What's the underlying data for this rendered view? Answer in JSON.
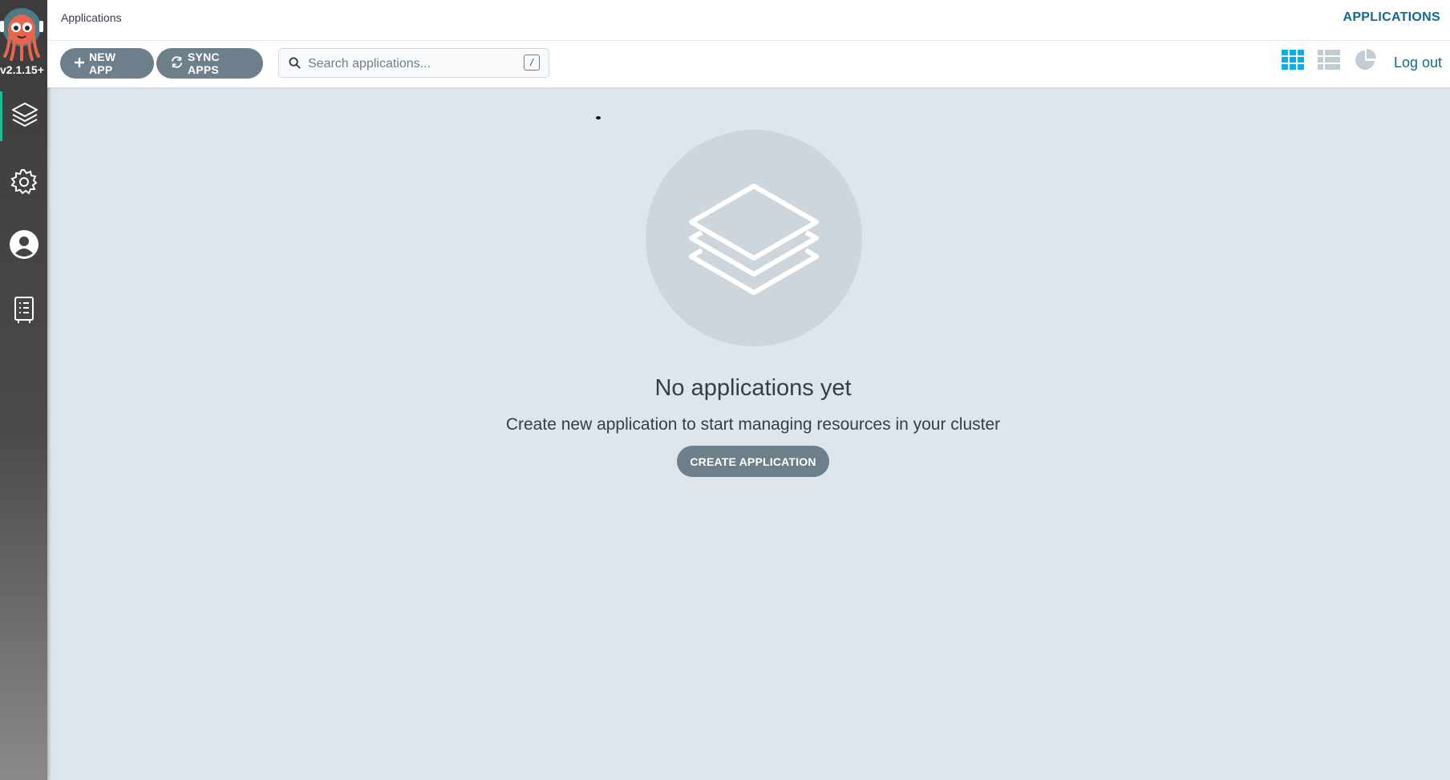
{
  "sidebar": {
    "version": "v2.1.15+",
    "items": [
      {
        "name": "applications",
        "icon": "layers-icon"
      },
      {
        "name": "settings",
        "icon": "gear-icon"
      },
      {
        "name": "user-info",
        "icon": "user-circle-icon"
      },
      {
        "name": "documentation",
        "icon": "book-icon"
      }
    ]
  },
  "header": {
    "title": "Applications",
    "nav_link": "APPLICATIONS"
  },
  "toolbar": {
    "new_app_label": "NEW APP",
    "sync_apps_label": "SYNC APPS",
    "search_placeholder": "Search applications...",
    "search_shortcut": "/",
    "views": [
      "tiles-view-icon",
      "list-view-icon",
      "summary-pie-icon"
    ],
    "active_view": "tiles",
    "logout_label": "Log out"
  },
  "empty_state": {
    "title": "No applications yet",
    "subtitle": "Create new application to start managing resources in your cluster",
    "button_label": "CREATE APPLICATION"
  },
  "colors": {
    "accent": "#0dadea",
    "link": "#0f6a8f",
    "button": "#6d7f8b",
    "background": "#dee6eb",
    "active_indicator": "#18be94"
  }
}
